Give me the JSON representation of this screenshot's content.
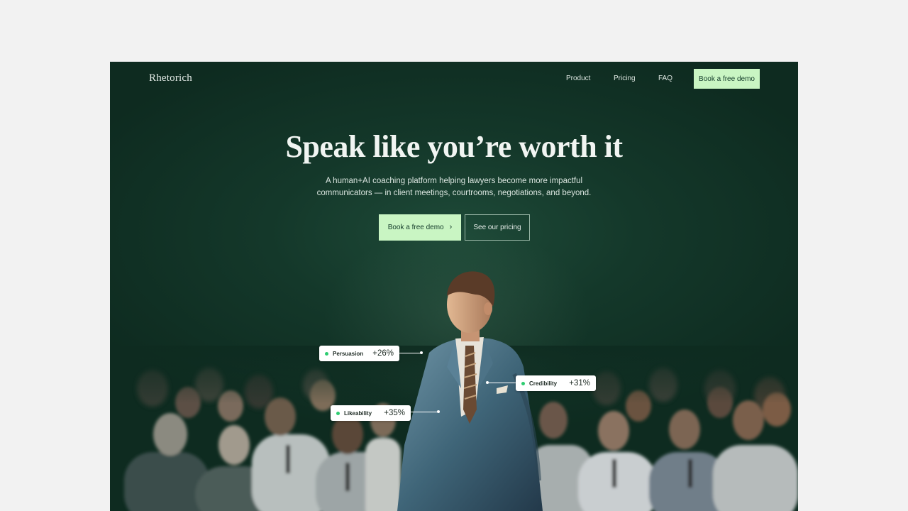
{
  "nav": {
    "brand": "Rhetorich",
    "links": [
      "Product",
      "Pricing",
      "FAQ"
    ],
    "cta": "Book a free demo"
  },
  "hero": {
    "title": "Speak like you’re worth it",
    "subtitle_line1": "A human+AI coaching platform helping lawyers become more impactful",
    "subtitle_line2": "communicators — in client meetings, courtrooms, negotiations, and beyond.",
    "primary_cta": "Book a free demo",
    "secondary_cta": "See our pricing"
  },
  "metrics": [
    {
      "label": "Persuasion",
      "value": "+26%"
    },
    {
      "label": "Credibility",
      "value": "+31%"
    },
    {
      "label": "Likeability",
      "value": "+35%"
    }
  ],
  "colors": {
    "background": "#0e2b20",
    "accent": "#c9f5c3",
    "indicator": "#2ecc71"
  },
  "icons": {
    "cta_chevron": "chevron-right-icon"
  }
}
